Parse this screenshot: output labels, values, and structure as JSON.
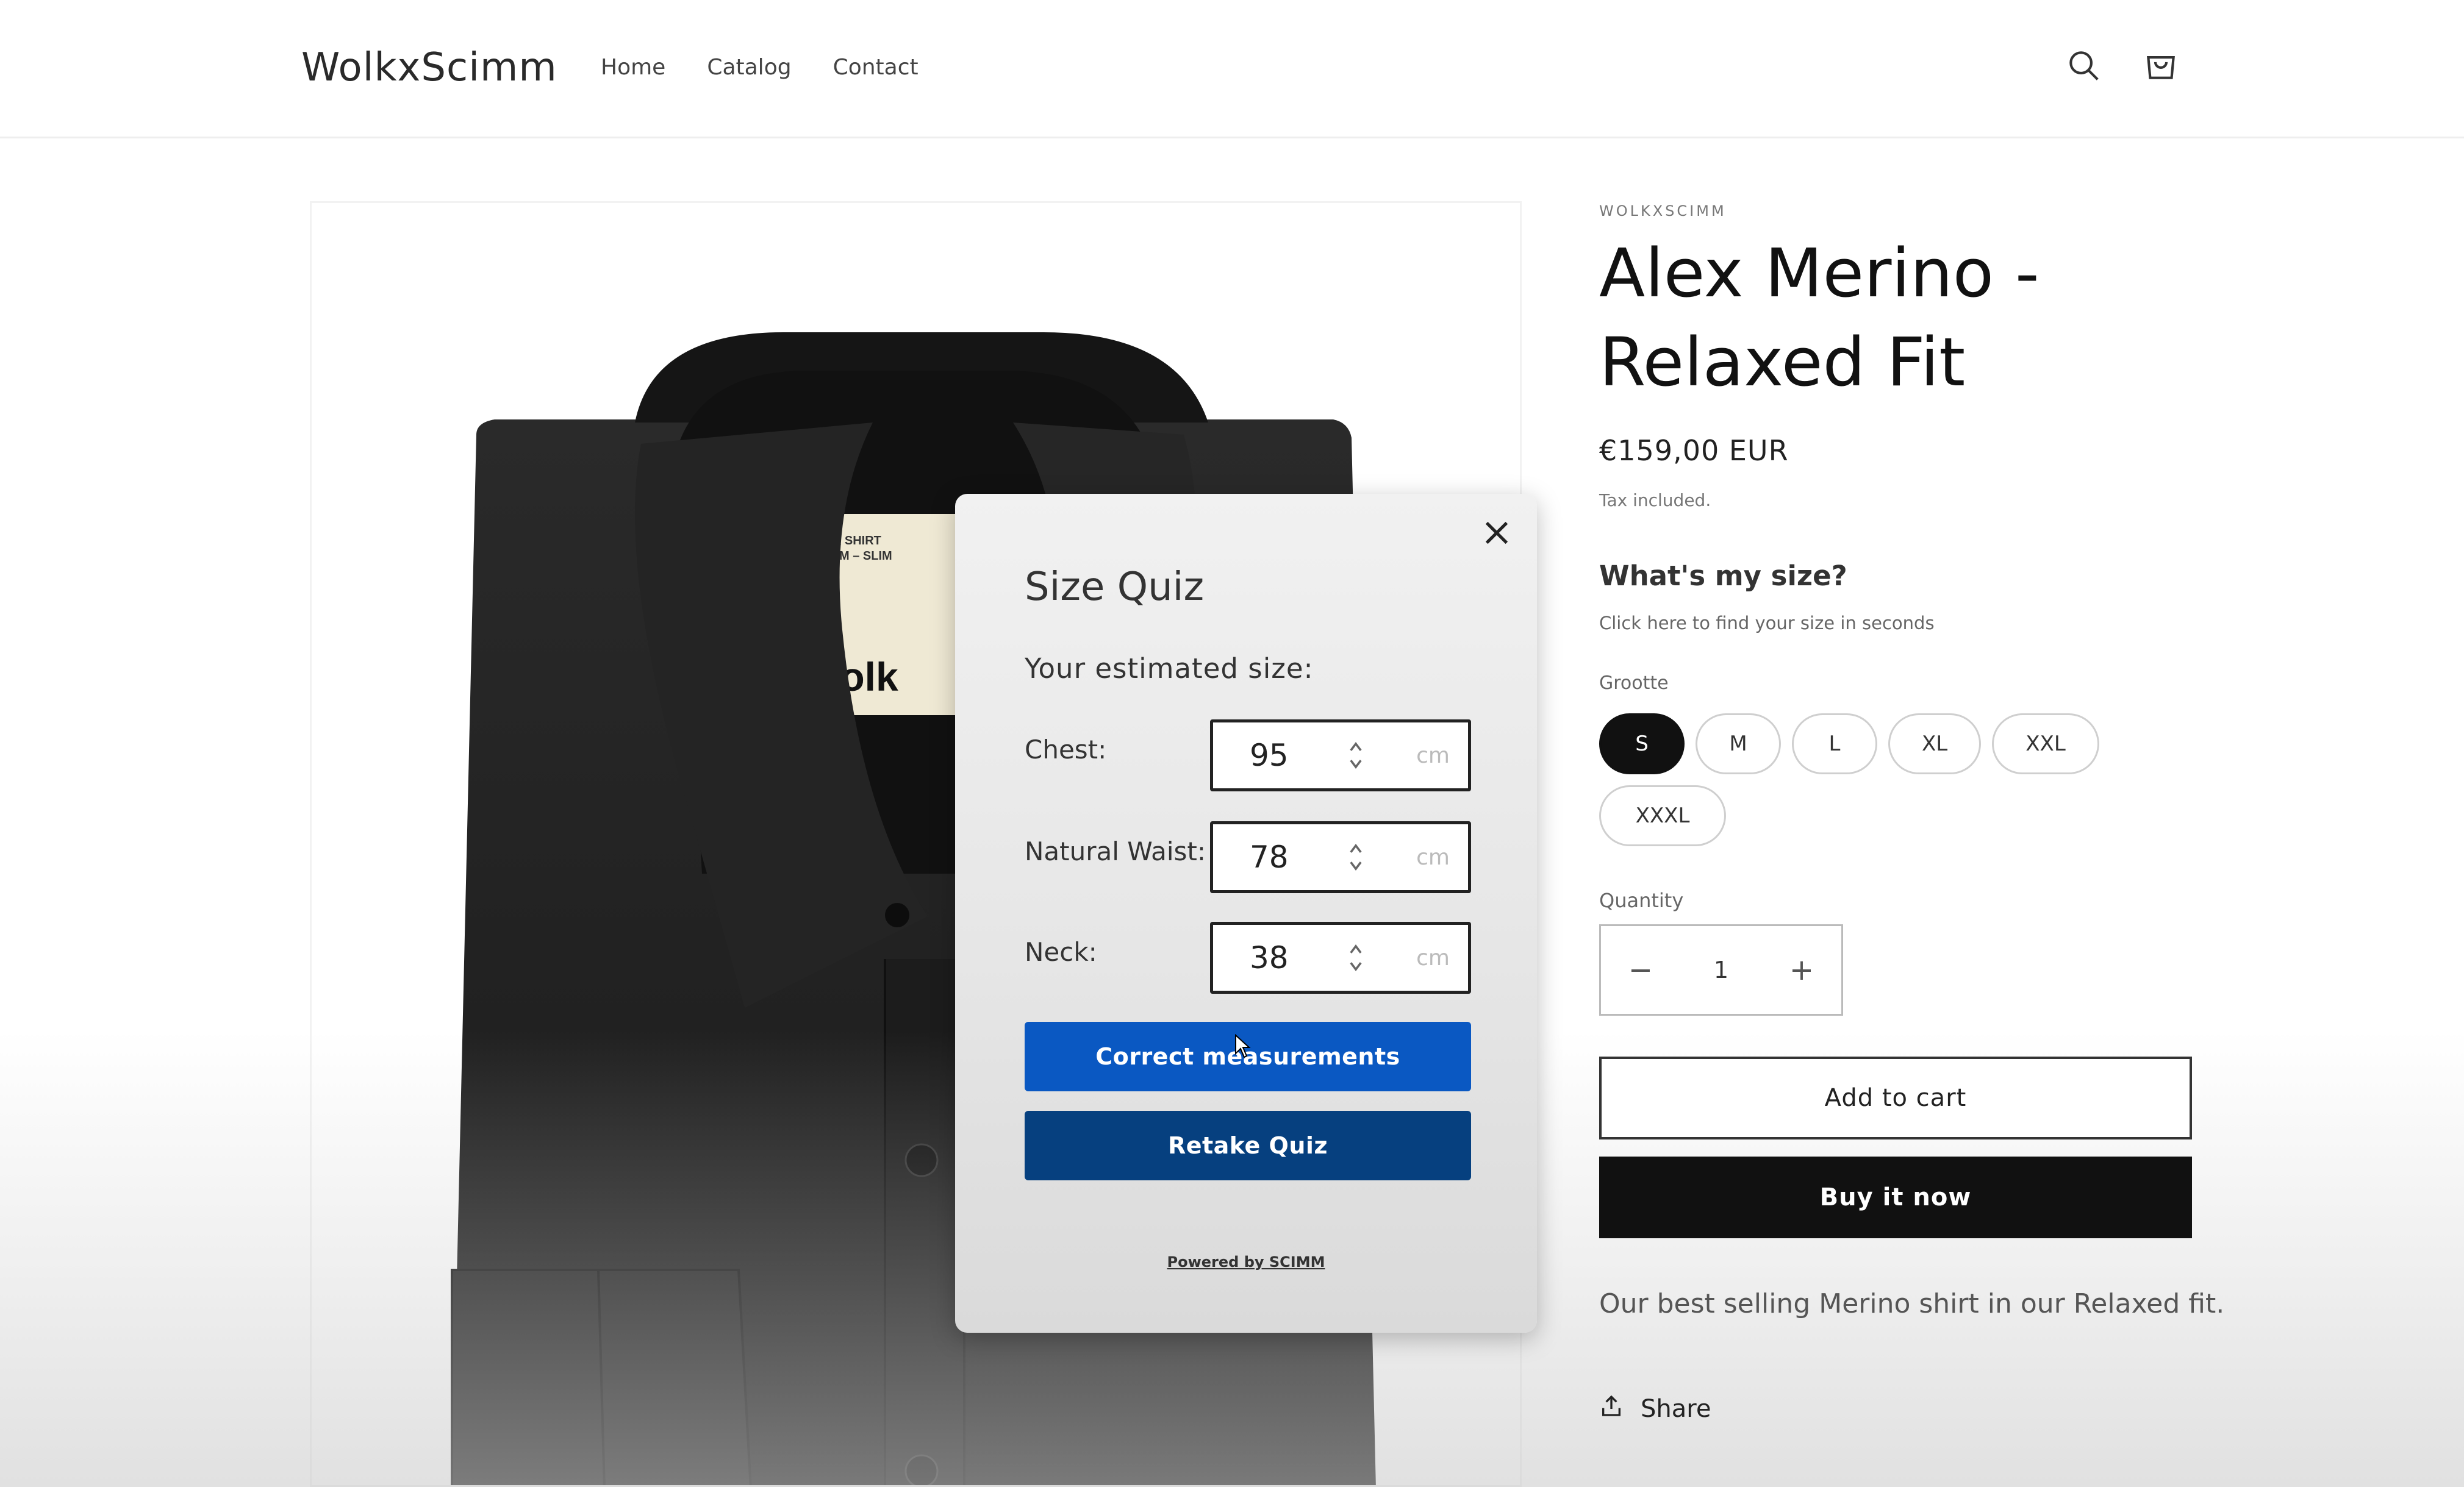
{
  "header": {
    "logo": "WolkxScimm",
    "nav": [
      "Home",
      "Catalog",
      "Contact"
    ],
    "icons": [
      "search-icon",
      "cart-icon"
    ]
  },
  "product": {
    "vendor": "WOLKXSCIMM",
    "title": "Alex Merino - Relaxed Fit",
    "price": "€159,00 EUR",
    "tax_note": "Tax included.",
    "whats_my_size": "What's my size?",
    "whats_my_size_sub": "Click here to find your size in seconds",
    "size_label": "Grootte",
    "sizes": [
      "S",
      "M",
      "L",
      "XL",
      "XXL",
      "XXXL"
    ],
    "selected_size": "S",
    "quantity_label": "Quantity",
    "quantity": "1",
    "add_to_cart": "Add to cart",
    "buy_now": "Buy it now",
    "description": "Our best selling Merino shirt in our Relaxed fit.",
    "share": "Share"
  },
  "image": {
    "label_line1": "ALEX SHIRT",
    "label_line2": "SIZE M – SLIM",
    "label_brand": "wolk"
  },
  "quiz": {
    "title": "Size Quiz",
    "subtitle": "Your estimated size:",
    "fields": [
      {
        "label": "Chest:",
        "value": "95",
        "unit": "cm"
      },
      {
        "label": "Natural Waist:",
        "value": "78",
        "unit": "cm"
      },
      {
        "label": "Neck:",
        "value": "38",
        "unit": "cm"
      }
    ],
    "correct_button": "Correct measurements",
    "retake_button": "Retake Quiz",
    "powered_by": "Powered by SCIMM"
  },
  "colors": {
    "primary_blue": "#0a58c2",
    "navy": "#06407f",
    "black": "#111111"
  }
}
